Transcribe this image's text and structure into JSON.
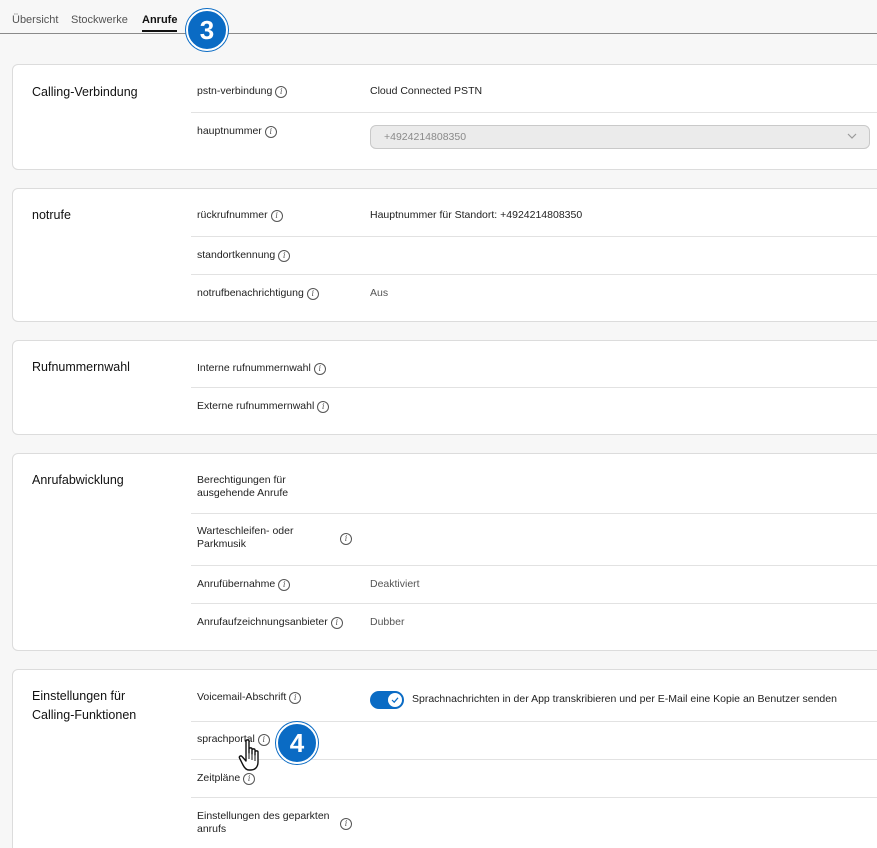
{
  "tabs": [
    {
      "label": "Übersicht"
    },
    {
      "label": "Stockwerke"
    },
    {
      "label": "Anrufe"
    }
  ],
  "badges": {
    "step3": "3",
    "step4": "4"
  },
  "colors": {
    "accent": "#0a6bc4"
  },
  "calling_connection": {
    "title": "Calling-Verbindung",
    "pstn_label": "pstn-verbindung",
    "pstn_value": "Cloud Connected PSTN",
    "main_number_label": "hauptnummer",
    "main_number_value": "+4924214808350"
  },
  "emergency": {
    "title": "notrufe",
    "callback_label": "rückrufnummer",
    "callback_value": "Hauptnummer für Standort: +4924214808350",
    "location_id_label": "standortkennung",
    "notification_label": "notrufbenachrichtigung",
    "notification_value": "Aus"
  },
  "dialing": {
    "title": "Rufnummernwahl",
    "internal_label": "Interne rufnummernwahl",
    "external_label": "Externe rufnummernwahl"
  },
  "call_handling": {
    "title": "Anrufabwicklung",
    "outgoing_label_1": "Berechtigungen für",
    "outgoing_label_2": "ausgehende Anrufe",
    "music_label_1": "Warteschleifen- oder",
    "music_label_2": "Parkmusik",
    "pickup_label": "Anrufübernahme",
    "pickup_value": "Deaktiviert",
    "recording_label": "Anrufaufzeichnungsanbieter",
    "recording_value": "Dubber"
  },
  "calling_features": {
    "title_1": "Einstellungen für",
    "title_2": "Calling-Funktionen",
    "voicemail_label": "Voicemail-Abschrift",
    "voicemail_toggle_on": true,
    "voicemail_text": "Sprachnachrichten in der App transkribieren und per E-Mail eine Kopie an Benutzer senden",
    "voice_portal_label": "sprachportal",
    "schedules_label": "Zeitpläne",
    "parked_label_1": "Einstellungen des geparkten",
    "parked_label_2": "anrufs"
  },
  "icons": {
    "info": "info-icon",
    "chevron": "chevron-down-icon",
    "check": "check-icon",
    "cursor": "hand-pointer-icon"
  }
}
